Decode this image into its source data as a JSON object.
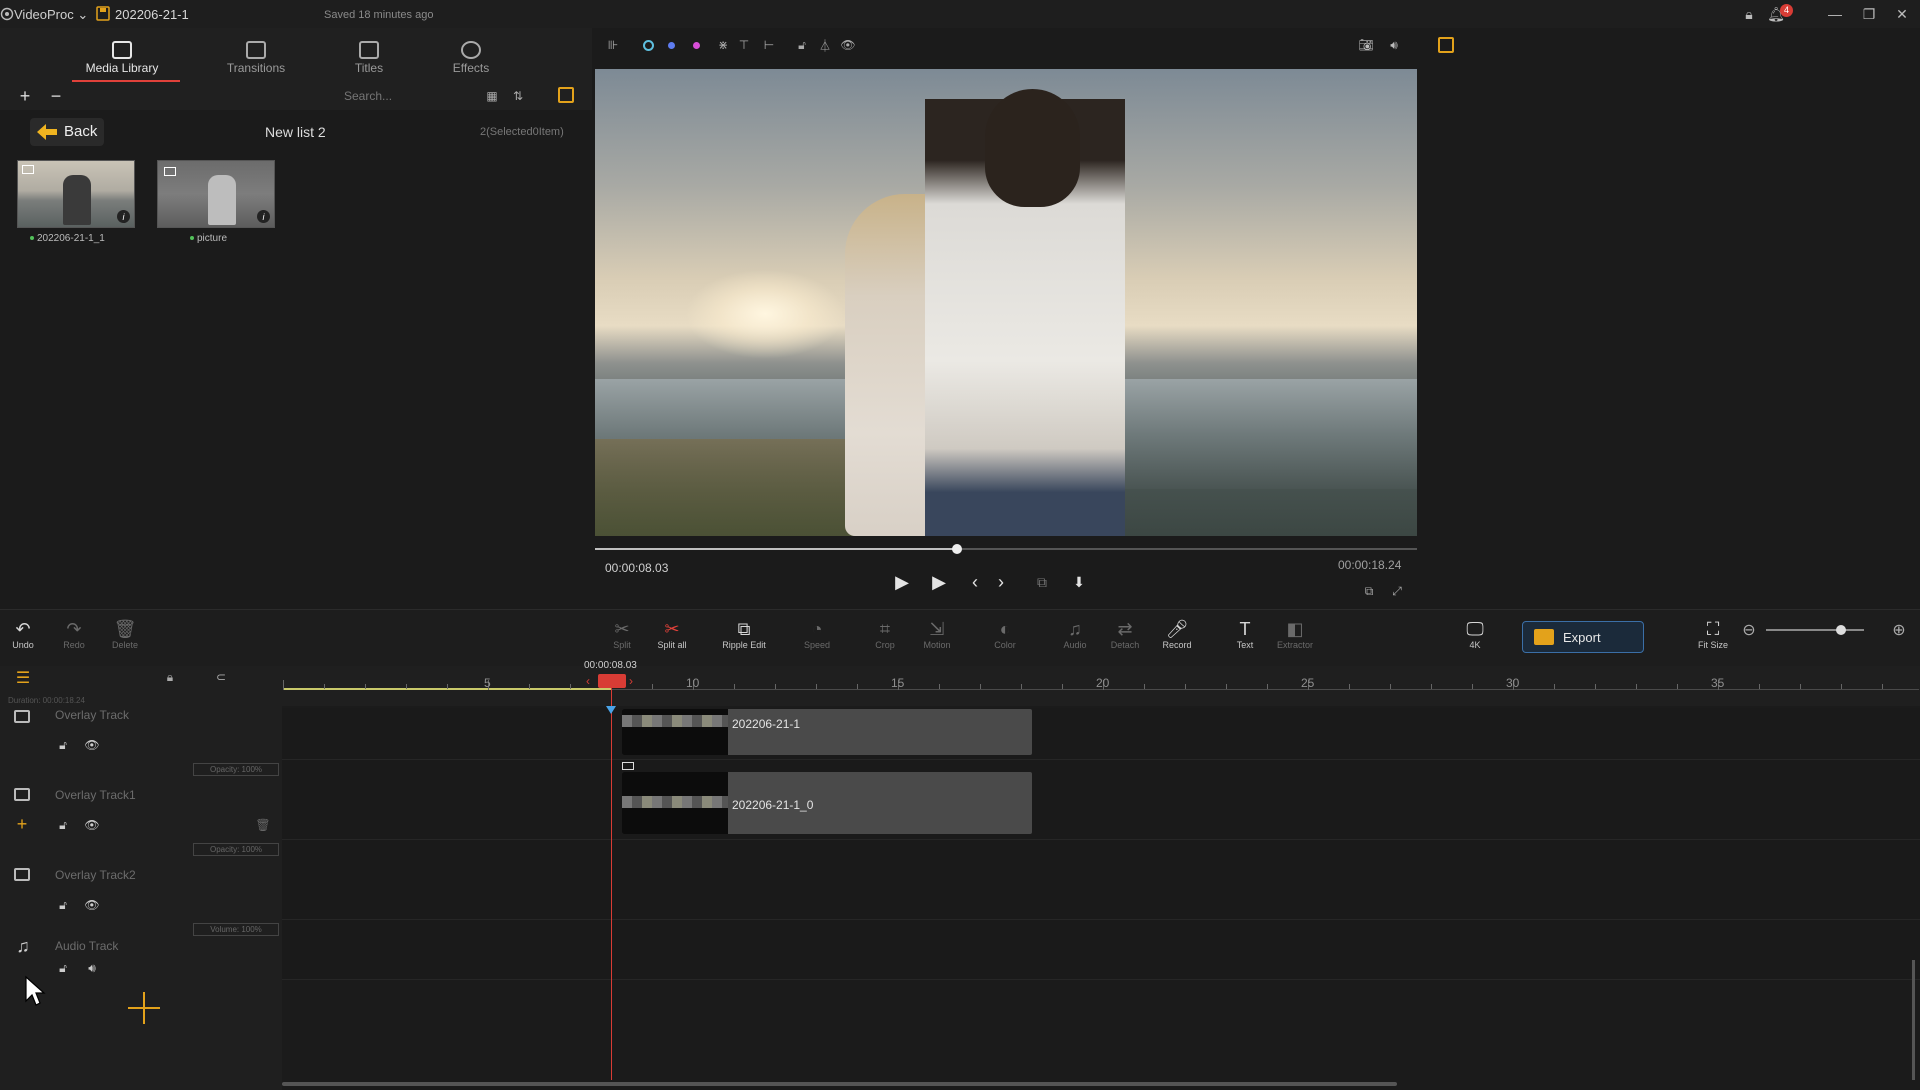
{
  "app": {
    "name": "VideoProc",
    "project": "202206-21-1",
    "saved": "Saved 18 minutes ago",
    "notification_count": "4"
  },
  "tabs": [
    {
      "label": "Media Library"
    },
    {
      "label": "Transitions"
    },
    {
      "label": "Titles"
    },
    {
      "label": "Effects"
    }
  ],
  "library": {
    "search_placeholder": "Search...",
    "back_label": "Back",
    "list_title": "New list 2",
    "count_text": "2(Selected0Item)",
    "items": [
      {
        "label": "202206-21-1_1"
      },
      {
        "label": "picture"
      }
    ]
  },
  "preview": {
    "current_time": "00:00:08.03",
    "duration": "00:00:18.24",
    "progress": 0.44
  },
  "toolbar": {
    "undo": "Undo",
    "redo": "Redo",
    "delete": "Delete",
    "split": "Split",
    "split_all": "Split all",
    "ripple_edit": "Ripple Edit",
    "speed": "Speed",
    "crop": "Crop",
    "motion": "Motion",
    "color": "Color",
    "audio": "Audio",
    "detach": "Detach",
    "record": "Record",
    "text": "Text",
    "extractor": "Extractor",
    "k4": "4K",
    "export": "Export",
    "fit_size": "Fit Size"
  },
  "timeline": {
    "playhead_time": "00:00:08.03",
    "duration_label": "Duration: 00:00:18.24",
    "ruler": [
      "5",
      "10",
      "15",
      "20",
      "25",
      "30",
      "35"
    ],
    "tracks": [
      {
        "name": "Overlay Track",
        "tag": "Opacity: 100%"
      },
      {
        "name": "Overlay Track1",
        "tag": "Opacity: 100%"
      },
      {
        "name": "Overlay Track2",
        "tag": "Volume: 100%"
      },
      {
        "name": "Audio Track"
      }
    ],
    "clips": [
      {
        "label": "202206-21-1"
      },
      {
        "label": "202206-21-1_0"
      }
    ]
  },
  "colors": {
    "accent": "#d83c35",
    "export_border": "#3b6fa7",
    "brand_yellow": "#e3a21b"
  }
}
